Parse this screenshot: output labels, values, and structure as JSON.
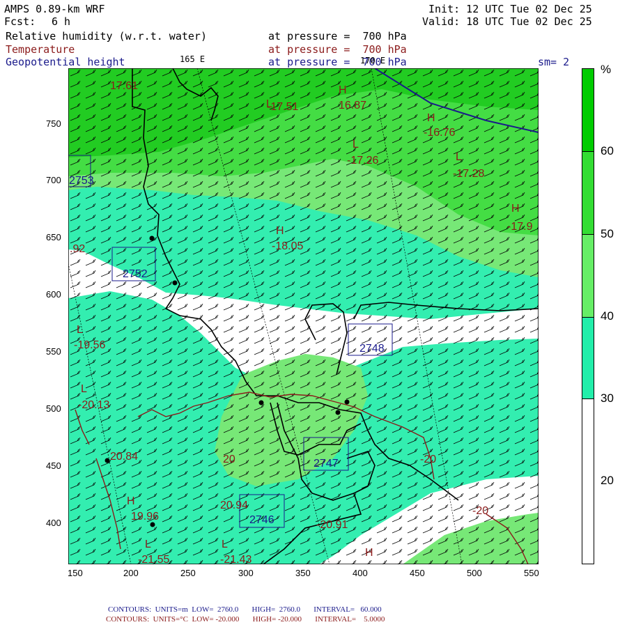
{
  "header": {
    "model": "AMPS 0.89-km WRF",
    "fcst_label": "Fcst:",
    "fcst_value": "6 h",
    "init": "Init: 12 UTC Tue 02 Dec 25",
    "valid": "Valid: 18 UTC Tue 02 Dec 25",
    "field1": "Relative humidity (w.r.t. water)",
    "field2": "Temperature",
    "field3": "Geopotential height",
    "pressure1": "at pressure =  700 hPa",
    "pressure2": "at pressure =  700 hPa",
    "pressure3": "at pressure =  700 hPa",
    "lon165": "165 E",
    "lon170": "170 E",
    "sm": "sm= 2"
  },
  "axes": {
    "x_ticks": [
      "150",
      "200",
      "250",
      "300",
      "350",
      "400",
      "450",
      "500",
      "550"
    ],
    "y_ticks": [
      "750",
      "700",
      "650",
      "600",
      "550",
      "500",
      "450",
      "400"
    ]
  },
  "colorbar": {
    "unit": "%",
    "labels": [
      "60",
      "50",
      "40",
      "30",
      "20"
    ],
    "colors": {
      "c60": "#00cc00",
      "c50": "#33dd33",
      "c40": "#66ee66",
      "c30": "#22eeaa",
      "c20": "#ffffff"
    }
  },
  "colors": {
    "rh_60": "#22cc22",
    "rh_50": "#44dd44",
    "rh_40": "#77e877",
    "rh_30": "#33eeb0",
    "coast": "#000000",
    "temp": "#8b1a1a",
    "height": "#1a1a8b"
  },
  "map_labels": {
    "t1": "17.61",
    "t2": "-17.51",
    "t3": "16.87",
    "t4": "-16.76",
    "t5": "-17.26",
    "t6": "-17.28",
    "t7": "-17.9",
    "t8": "-18.05",
    "t9": "-19.56",
    "t10": "-20.13",
    "t11": "20.84",
    "t12": "19.96",
    "t13": "-21.55",
    "t14": "-21.43",
    "t15": "20.94",
    "t16": "-20.91",
    "t17": "-20",
    "t18": "-20",
    "t19": "20",
    "t20": ".92",
    "z1": "2753",
    "z2": "2752",
    "z3": "2748",
    "z4": "2747",
    "z5": "2746",
    "hL": "L",
    "hH": "H"
  },
  "footer": {
    "line1": "CONTOURS:  UNITS=m  LOW=  2760.0       HIGH=  2760.0       INTERVAL=   60.000",
    "line2": "CONTOURS:  UNITS=°C  LOW= -20.000       HIGH= -20.000       INTERVAL=    5.0000"
  }
}
